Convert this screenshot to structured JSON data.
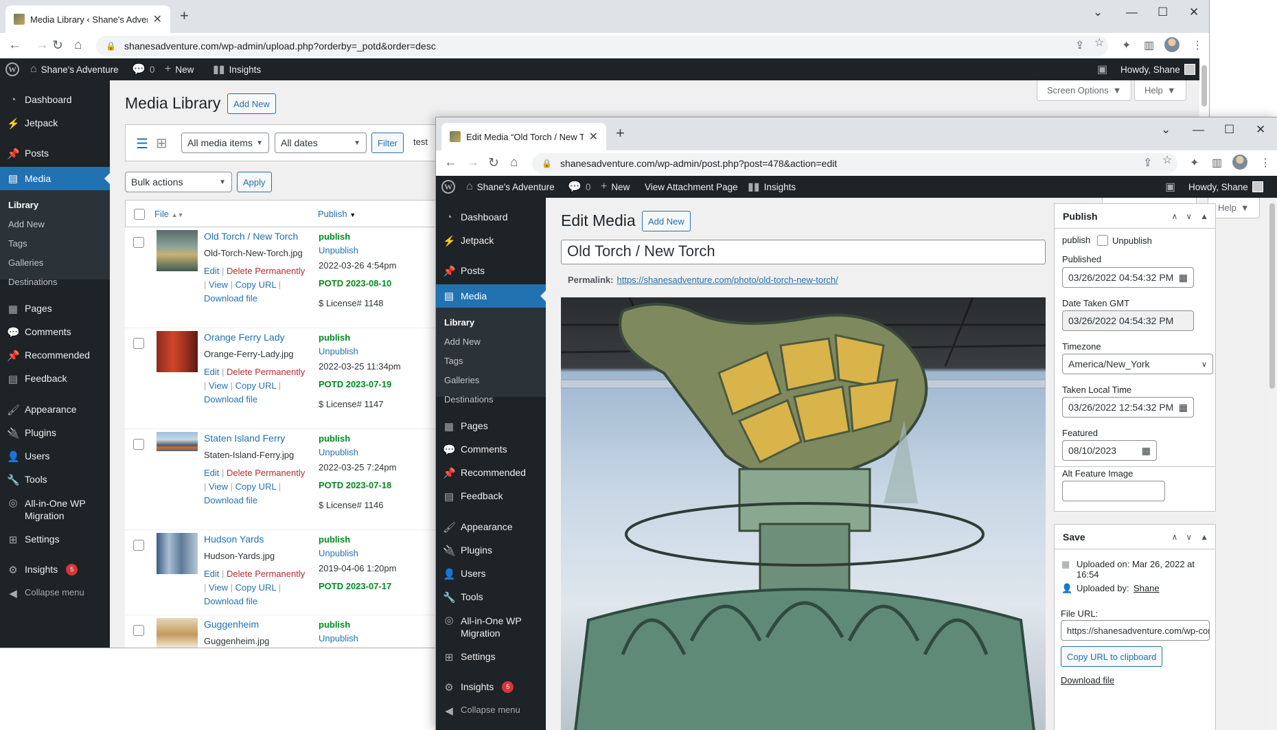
{
  "browser1": {
    "tab_title": "Media Library ‹ Shane's Adventu",
    "url": "shanesadventure.com/wp-admin/upload.php?orderby=_potd&order=desc"
  },
  "browser2": {
    "tab_title": "Edit Media “Old Torch / New Tor",
    "url": "shanesadventure.com/wp-admin/post.php?post=478&action=edit"
  },
  "adminbar": {
    "site_name": "Shane's Adventure",
    "comments_count": "0",
    "new_label": "New",
    "insights_label": "Insights",
    "view_attachment": "View Attachment Page",
    "howdy": "Howdy, Shane"
  },
  "screen_options": "Screen Options",
  "help": "Help",
  "menu": {
    "dashboard": "Dashboard",
    "jetpack": "Jetpack",
    "posts": "Posts",
    "media": "Media",
    "library": "Library",
    "add_new": "Add New",
    "tags": "Tags",
    "galleries": "Galleries",
    "destinations": "Destinations",
    "pages": "Pages",
    "comments": "Comments",
    "recommended": "Recommended",
    "feedback": "Feedback",
    "appearance": "Appearance",
    "plugins": "Plugins",
    "users": "Users",
    "tools": "Tools",
    "aio_line1": "All-in-One WP",
    "aio_line2": "Migration",
    "settings": "Settings",
    "insights": "Insights",
    "insights_badge": "5",
    "collapse": "Collapse menu"
  },
  "library": {
    "title": "Media Library",
    "add_new": "Add New",
    "filter_type": "All media items",
    "filter_date": "All dates",
    "filter_btn": "Filter",
    "search_value": "test",
    "bulk_actions": "Bulk actions",
    "apply": "Apply",
    "col_file": "File",
    "col_publish": "Publish",
    "row_actions": {
      "edit": "Edit",
      "delete": "Delete Permanently",
      "view": "View",
      "copy": "Copy URL",
      "download": "Download file",
      "sep": "|"
    },
    "rows": [
      {
        "title": "Old Torch / New Torch",
        "file": "Old-Torch-New-Torch.jpg",
        "status": "publish",
        "unpublish": "Unpublish",
        "date": "2022-03-26 4:54pm",
        "potd": "POTD 2023-08-10",
        "license": "$ License# 1148"
      },
      {
        "title": "Orange Ferry Lady",
        "file": "Orange-Ferry-Lady.jpg",
        "status": "publish",
        "unpublish": "Unpublish",
        "date": "2022-03-25 11:34pm",
        "potd": "POTD 2023-07-19",
        "license": "$ License# 1147"
      },
      {
        "title": "Staten Island Ferry",
        "file": "Staten-Island-Ferry.jpg",
        "status": "publish",
        "unpublish": "Unpublish",
        "date": "2022-03-25 7:24pm",
        "potd": "POTD 2023-07-18",
        "license": "$ License# 1146"
      },
      {
        "title": "Hudson Yards",
        "file": "Hudson-Yards.jpg",
        "status": "publish",
        "unpublish": "Unpublish",
        "date": "2019-04-06 1:20pm",
        "potd": "POTD 2023-07-17",
        "license": ""
      },
      {
        "title": "Guggenheim",
        "file": "Guggenheim.jpg",
        "status": "publish",
        "unpublish": "Unpublish",
        "date": "",
        "potd": "",
        "license": ""
      }
    ]
  },
  "edit": {
    "title": "Edit Media",
    "add_new": "Add New",
    "post_title": "Old Torch / New Torch",
    "permalink_label": "Permalink:",
    "permalink_url": "https://shanesadventure.com/photo/old-torch-new-torch/",
    "publish_box": {
      "heading": "Publish",
      "status": "publish",
      "unpublish": "Unpublish",
      "published_label": "Published",
      "published_value": "03/26/2022 04:54:32 PM",
      "date_taken_label": "Date Taken GMT",
      "date_taken_value": "03/26/2022 04:54:32 PM",
      "timezone_label": "Timezone",
      "timezone_value": "America/New_York",
      "local_label": "Taken Local Time",
      "local_value": "03/26/2022 12:54:32 PM",
      "featured_label": "Featured",
      "featured_value": "08/10/2023",
      "alt_label": "Alt Feature Image",
      "alt_value": ""
    },
    "save_box": {
      "heading": "Save",
      "uploaded_on": "Uploaded on: Mar 26, 2022 at 16:54",
      "uploaded_by_label": "Uploaded by:",
      "uploaded_by": "Shane",
      "file_url_label": "File URL:",
      "file_url": "https://shanesadventure.com/wp-conte",
      "copy_btn": "Copy URL to clipboard",
      "download": "Download file"
    }
  },
  "colors": {
    "admin_bar": "#1d2327",
    "accent": "#2271b1",
    "delete": "#b32d2e",
    "potd": "#008a20"
  }
}
